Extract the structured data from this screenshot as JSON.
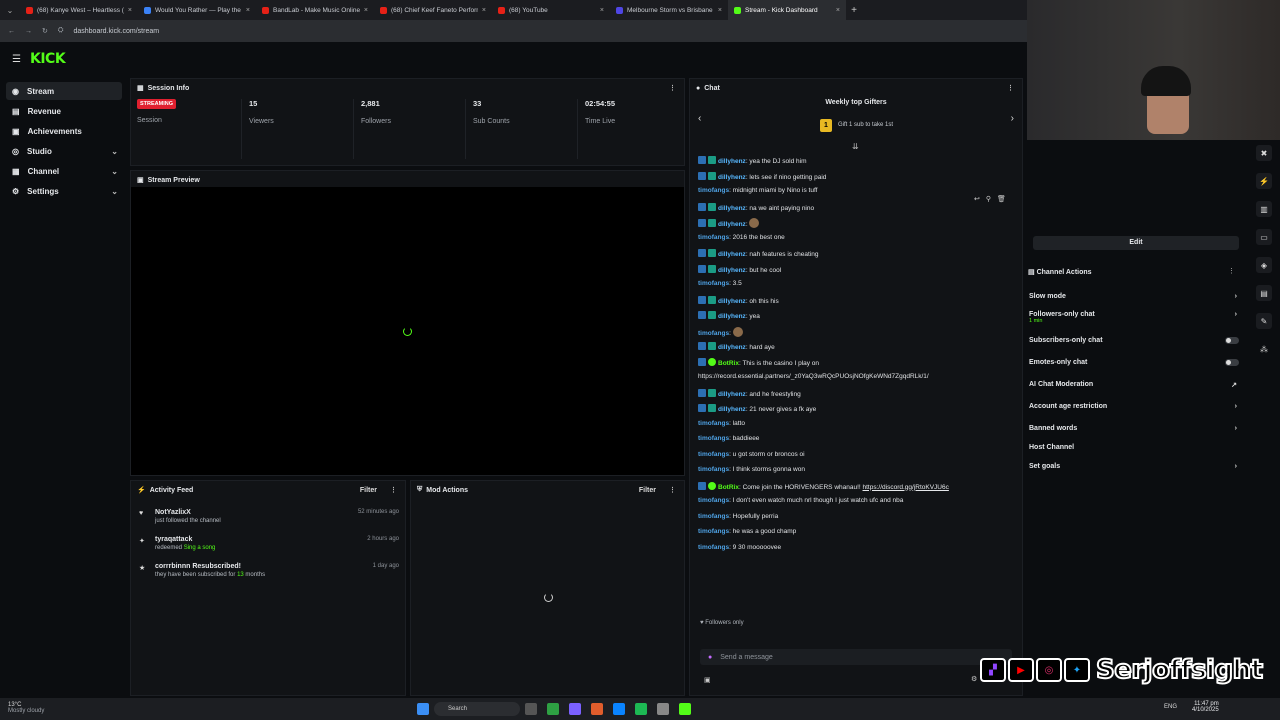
{
  "browser": {
    "tabs": [
      {
        "label": "(68) Kanye West – Heartless (Li…",
        "color": "#e62117"
      },
      {
        "label": "Would You Rather — Play the O…",
        "color": "#3b82f6"
      },
      {
        "label": "BandLab - Make Music Online",
        "color": "#e62117"
      },
      {
        "label": "(68) Chief Keef Faneto Perform…",
        "color": "#e62117"
      },
      {
        "label": "(68) YouTube",
        "color": "#e62117"
      },
      {
        "label": "Melbourne Storm vs Brisbane B…",
        "color": "#4f46e5"
      },
      {
        "label": "Stream - Kick Dashboard",
        "color": "#53fc18"
      }
    ],
    "url": "dashboard.kick.com/stream"
  },
  "brand": {
    "logo": "KICK",
    "accent": "#53fc18"
  },
  "sidebar": {
    "items": [
      {
        "label": "Stream",
        "icon": "broadcast-icon"
      },
      {
        "label": "Revenue",
        "icon": "revenue-icon"
      },
      {
        "label": "Achievements",
        "icon": "trophy-icon"
      },
      {
        "label": "Studio",
        "icon": "studio-icon"
      },
      {
        "label": "Channel",
        "icon": "channel-icon"
      },
      {
        "label": "Settings",
        "icon": "gear-icon"
      }
    ]
  },
  "session": {
    "title": "Session Info",
    "status_badge": "STREAMING",
    "stats": [
      {
        "value": "",
        "label": "Session"
      },
      {
        "value": "15",
        "label": "Viewers"
      },
      {
        "value": "2,881",
        "label": "Followers"
      },
      {
        "value": "33",
        "label": "Sub Counts"
      },
      {
        "value": "02:54:55",
        "label": "Time Live"
      }
    ]
  },
  "preview": {
    "title": "Stream Preview"
  },
  "activity": {
    "title": "Activity Feed",
    "filter": "Filter",
    "items": [
      {
        "name": "NotYazlixX",
        "sub_pre": "just followed the channel",
        "sub_hl": "",
        "sub_post": "",
        "time": "52 minutes ago"
      },
      {
        "name": "tyraqattack",
        "sub_pre": "redeemed ",
        "sub_hl": "Sing a song",
        "sub_post": "",
        "time": "2 hours ago"
      },
      {
        "name": "corrrbinnn Resubscribed!",
        "sub_pre": "they have been subscribed for ",
        "sub_hl": "13",
        "sub_post": " months",
        "time": "1 day ago"
      }
    ]
  },
  "mod": {
    "title": "Mod Actions",
    "filter": "Filter"
  },
  "chat": {
    "title": "Chat",
    "gifters_title": "Weekly top Gifters",
    "gifters_rank": "1",
    "gifters_text": "Gift 1 sub to take 1st",
    "messages": [
      {
        "user": "dillyhenz",
        "text": ": yea the DJ sold him",
        "kind": "badged"
      },
      {
        "user": "dillyhenz",
        "text": ": lets see if nino getting paid",
        "kind": "badged"
      },
      {
        "user": "timofangs",
        "text": ": midnight miami by Nino is tuff",
        "kind": "plain"
      },
      {
        "user": "dillyhenz",
        "text": ": na we aint paying nino",
        "kind": "badged"
      },
      {
        "user": "dillyhenz",
        "text": ": ",
        "kind": "badged-emote"
      },
      {
        "user": "timofangs",
        "text": ": 2016 the best one",
        "kind": "plain"
      },
      {
        "user": "dillyhenz",
        "text": ": nah features is cheating",
        "kind": "badged"
      },
      {
        "user": "dillyhenz",
        "text": ": but he cool",
        "kind": "badged"
      },
      {
        "user": "timofangs",
        "text": ": 3.5",
        "kind": "plain"
      },
      {
        "user": "dillyhenz",
        "text": ": oh this his",
        "kind": "badged"
      },
      {
        "user": "dillyhenz",
        "text": ": yea",
        "kind": "badged"
      },
      {
        "user": "timofangs",
        "text": ": ",
        "kind": "plain-emote"
      },
      {
        "user": "dillyhenz",
        "text": ": hard aye",
        "kind": "badged"
      },
      {
        "user": "BotRix",
        "text": ": This is the casino I play on",
        "kind": "bot"
      },
      {
        "user": "",
        "text": "https://record.essential.partners/_z0YaQ3wRQcPUOsjNOfgKeWNd7ZgqdRLk/1/",
        "kind": "cont"
      },
      {
        "user": "dillyhenz",
        "text": ": and he freestyling",
        "kind": "badged"
      },
      {
        "user": "dillyhenz",
        "text": ": 21 never gives a fk aye",
        "kind": "badged"
      },
      {
        "user": "timofangs",
        "text": ": latto",
        "kind": "plain"
      },
      {
        "user": "timofangs",
        "text": ": baddieee",
        "kind": "plain"
      },
      {
        "user": "timofangs",
        "text": ": u got storm or broncos oi",
        "kind": "plain"
      },
      {
        "user": "timofangs",
        "text": ": I think storms gonna won",
        "kind": "plain"
      },
      {
        "user": "BotRix",
        "text": ": Come join the HORIVENGERS whanau!! ",
        "link": "https://discord.gg/jRtoKVJU6c",
        "kind": "bot"
      },
      {
        "user": "timofangs",
        "text": ": I don't even watch much nrl though I just watch ufc and nba",
        "kind": "plain"
      },
      {
        "user": "timofangs",
        "text": ": Hopefully perria",
        "kind": "plain"
      },
      {
        "user": "timofangs",
        "text": ": he was a good champ",
        "kind": "plain"
      },
      {
        "user": "timofangs",
        "text": ": 9 30 mooooovee",
        "kind": "plain"
      }
    ],
    "followers_only": "Followers only",
    "placeholder": "Send a message"
  },
  "channel_actions": {
    "edit": "Edit",
    "title": "Channel Actions",
    "items": [
      {
        "label": "Slow mode",
        "sub": "",
        "control": "chevron"
      },
      {
        "label": "Followers-only chat",
        "sub": "1 min",
        "control": "chevron"
      },
      {
        "label": "Subscribers-only chat",
        "sub": "",
        "control": "toggle"
      },
      {
        "label": "Emotes-only chat",
        "sub": "",
        "control": "toggle"
      },
      {
        "label": "AI Chat Moderation",
        "sub": "",
        "control": "external"
      },
      {
        "label": "Account age restriction",
        "sub": "",
        "control": "chevron"
      },
      {
        "label": "Banned words",
        "sub": "",
        "control": "chevron"
      },
      {
        "label": "Host Channel",
        "sub": "",
        "control": "none"
      },
      {
        "label": "Set goals",
        "sub": "",
        "control": "chevron"
      }
    ]
  },
  "overlay": {
    "name": "Serjoffsight"
  },
  "taskbar": {
    "weather_temp": "13°C",
    "weather_desc": "Mostly cloudy",
    "search": "Search",
    "lang": "ENG",
    "time": "11:47 pm",
    "date": "4/10/2025"
  }
}
